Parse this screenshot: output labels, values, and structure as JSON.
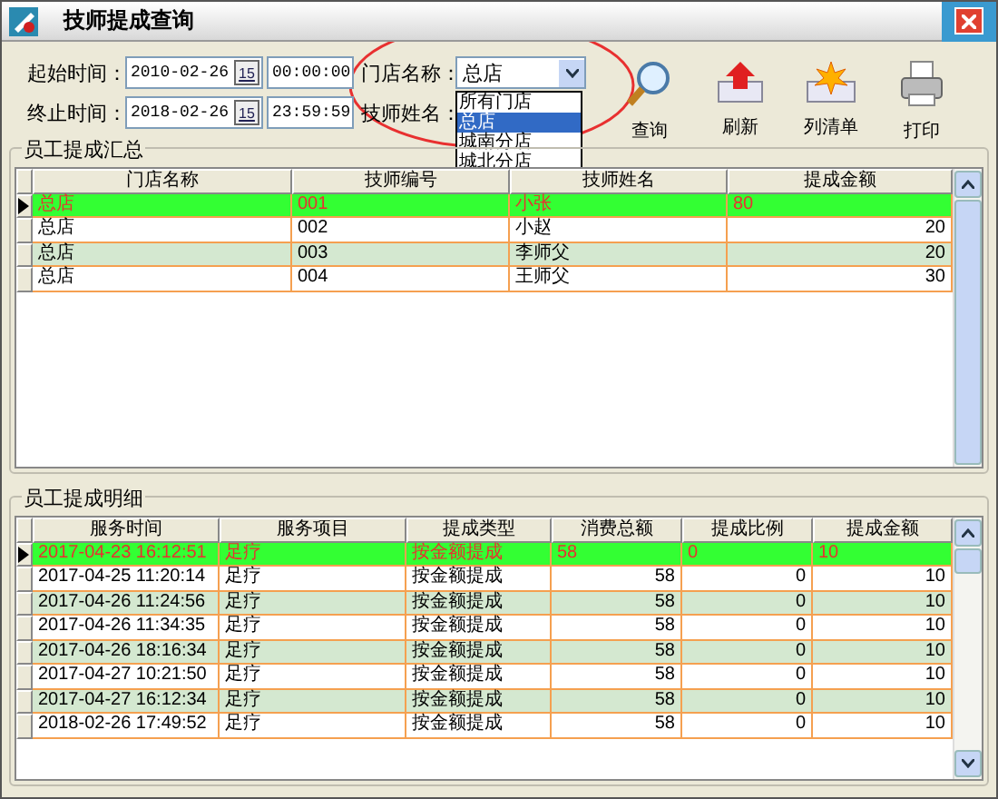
{
  "window": {
    "title": "技师提成查询"
  },
  "filters": {
    "start_label": "起始时间：",
    "start_date": "2010-02-26",
    "start_time": "00:00:00",
    "end_label": "终止时间：",
    "end_date": "2018-02-26",
    "end_time": "23:59:59",
    "start_calendar": "15",
    "end_calendar": "15",
    "store_label": "门店名称：",
    "store_value": "总店",
    "technician_label": "技师姓名：",
    "store_options": [
      {
        "label": "所有门店",
        "selected": false
      },
      {
        "label": "总店",
        "selected": true
      },
      {
        "label": "城南分店",
        "selected": false
      },
      {
        "label": "城北分店",
        "selected": false
      }
    ]
  },
  "toolbar": [
    {
      "kind": "search",
      "label": "查询"
    },
    {
      "kind": "refresh",
      "label": "刷新"
    },
    {
      "kind": "list",
      "label": "列清单"
    },
    {
      "kind": "print",
      "label": "打印"
    }
  ],
  "summary": {
    "title": "员工提成汇总",
    "columns": [
      "门店名称",
      "技师编号",
      "技师姓名",
      "提成金额"
    ],
    "numeric": [
      false,
      false,
      false,
      true
    ],
    "rows": [
      {
        "selected": true,
        "cells": [
          "总店",
          "001",
          "小张",
          "80"
        ]
      },
      {
        "selected": false,
        "cells": [
          "总店",
          "002",
          "小赵",
          "20"
        ]
      },
      {
        "selected": false,
        "cells": [
          "总店",
          "003",
          "李师父",
          "20"
        ]
      },
      {
        "selected": false,
        "cells": [
          "总店",
          "004",
          "王师父",
          "30"
        ]
      }
    ]
  },
  "detail": {
    "title": "员工提成明细",
    "columns": [
      "服务时间",
      "服务项目",
      "提成类型",
      "消费总额",
      "提成比例",
      "提成金额"
    ],
    "numeric": [
      false,
      false,
      false,
      true,
      true,
      true
    ],
    "rows": [
      {
        "selected": true,
        "cells": [
          "2017-04-23 16:12:51",
          "足疗",
          "按金额提成",
          "58",
          "0",
          "10"
        ]
      },
      {
        "selected": false,
        "cells": [
          "2017-04-25 11:20:14",
          "足疗",
          "按金额提成",
          "58",
          "0",
          "10"
        ]
      },
      {
        "selected": false,
        "cells": [
          "2017-04-26 11:24:56",
          "足疗",
          "按金额提成",
          "58",
          "0",
          "10"
        ]
      },
      {
        "selected": false,
        "cells": [
          "2017-04-26 11:34:35",
          "足疗",
          "按金额提成",
          "58",
          "0",
          "10"
        ]
      },
      {
        "selected": false,
        "cells": [
          "2017-04-26 18:16:34",
          "足疗",
          "按金额提成",
          "58",
          "0",
          "10"
        ]
      },
      {
        "selected": false,
        "cells": [
          "2017-04-27 10:21:50",
          "足疗",
          "按金额提成",
          "58",
          "0",
          "10"
        ]
      },
      {
        "selected": false,
        "cells": [
          "2017-04-27 16:12:34",
          "足疗",
          "按金额提成",
          "58",
          "0",
          "10"
        ]
      },
      {
        "selected": false,
        "cells": [
          "2018-02-26 17:49:52",
          "足疗",
          "按金额提成",
          "58",
          "0",
          "10"
        ]
      }
    ]
  }
}
